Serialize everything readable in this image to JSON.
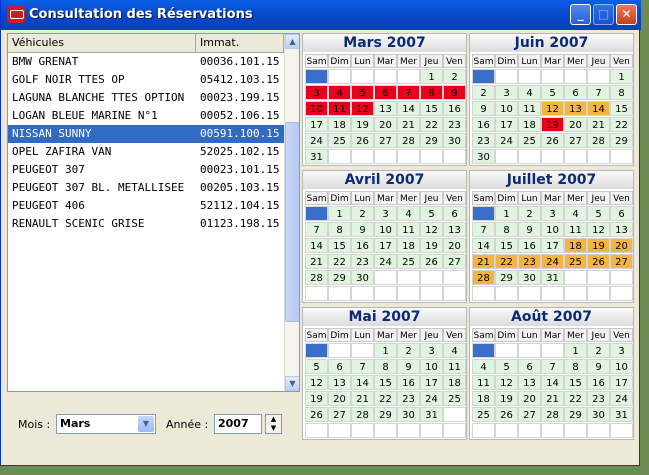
{
  "window": {
    "title": "Consultation des Réservations",
    "minimize": "_",
    "maximize": "□",
    "close": "✕"
  },
  "list": {
    "columns": [
      "Véhicules",
      "Immat."
    ],
    "rows": [
      [
        "BMW GRENAT",
        "00036.101.15"
      ],
      [
        "GOLF NOIR TTES OP",
        "05412.103.15"
      ],
      [
        "LAGUNA BLANCHE TTES OPTION",
        "00023.199.15"
      ],
      [
        "LOGAN BLEUE MARINE N°1",
        "00052.106.15"
      ],
      [
        "NISSAN SUNNY",
        "00591.100.15"
      ],
      [
        "OPEL ZAFIRA VAN",
        "52025.102.15"
      ],
      [
        "PEUGEOT 307",
        "00023.101.15"
      ],
      [
        "PEUGEOT 307 BL. METALLISEE",
        "00205.103.15"
      ],
      [
        "PEUGEOT 406",
        "52112.104.15"
      ],
      [
        "RENAULT SCENIC GRISE",
        "01123.198.15"
      ]
    ],
    "selected_index": 4
  },
  "controls": {
    "mois_label": "Mois :",
    "mois_value": "Mars",
    "annee_label": "Année :",
    "annee_value": "2007"
  },
  "weekdays": [
    "Sam",
    "Dim",
    "Lun",
    "Mar",
    "Mer",
    "Jeu",
    "Ven"
  ],
  "calendars": [
    {
      "title": "Mars 2007",
      "offset": 5,
      "days": 31,
      "red": [
        3,
        4,
        5,
        6,
        7,
        8,
        9,
        10,
        11,
        12
      ],
      "orange": [],
      "blue_rows": [
        0
      ]
    },
    {
      "title": "Juin 2007",
      "offset": 6,
      "days": 30,
      "red": [
        19
      ],
      "orange": [
        12,
        13,
        14
      ],
      "blue_rows": [
        0
      ]
    },
    {
      "title": "Avril 2007",
      "offset": 1,
      "days": 30,
      "red": [],
      "orange": [],
      "blue_rows": [
        0
      ]
    },
    {
      "title": "Juillet 2007",
      "offset": 1,
      "days": 31,
      "red": [],
      "orange": [
        18,
        19,
        20,
        21,
        22,
        23,
        24,
        25,
        26,
        27,
        28
      ],
      "blue_rows": [
        0
      ]
    },
    {
      "title": "Mai 2007",
      "offset": 3,
      "days": 31,
      "red": [],
      "orange": [],
      "blue_rows": [
        0
      ]
    },
    {
      "title": "Août 2007",
      "offset": 4,
      "days": 31,
      "red": [],
      "orange": [],
      "blue_rows": [
        0
      ]
    }
  ],
  "colors": {
    "booked": "#e8001c",
    "reserved": "#f4b440",
    "free": "#dff5df",
    "marker": "#3a6fc9"
  }
}
